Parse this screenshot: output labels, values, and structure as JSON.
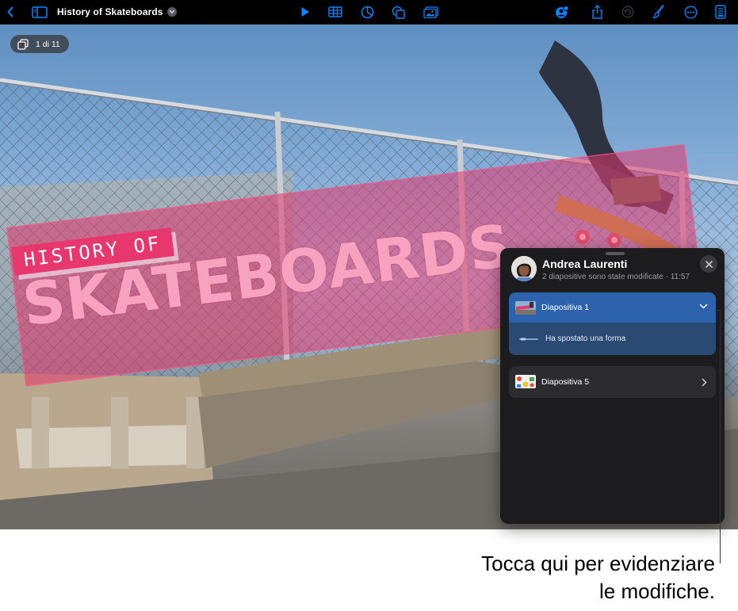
{
  "toolbar": {
    "document_title": "History of Skateboards",
    "icons": [
      "chevron-left-icon",
      "sidebar-icon",
      "title-chevron-icon",
      "play-icon",
      "table-icon",
      "chart-icon",
      "shape-icon",
      "media-icon",
      "collaborate-icon",
      "share-icon",
      "undo-icon",
      "format-brush-icon",
      "more-icon",
      "presenter-notes-icon"
    ],
    "accent_color": "#0a84ff"
  },
  "slide": {
    "counter": "1 di 11",
    "history_tag": "HISTORY OF",
    "title": "SKATEBOARDS",
    "title_color": "#f7a3bf",
    "band_color": "#e4376c"
  },
  "panel": {
    "user_name": "Andrea Laurenti",
    "summary": "2 diapositive sono state modificate",
    "time": "11:57",
    "rows": [
      {
        "label": "Diapositiva 1",
        "expanded": true,
        "change": "Ha spostato una forma"
      },
      {
        "label": "Diapositiva 5",
        "expanded": false
      }
    ],
    "selected_color": "#2d63ad"
  },
  "callout": {
    "line1": "Tocca qui per evidenziare",
    "line2": "le modifiche."
  }
}
